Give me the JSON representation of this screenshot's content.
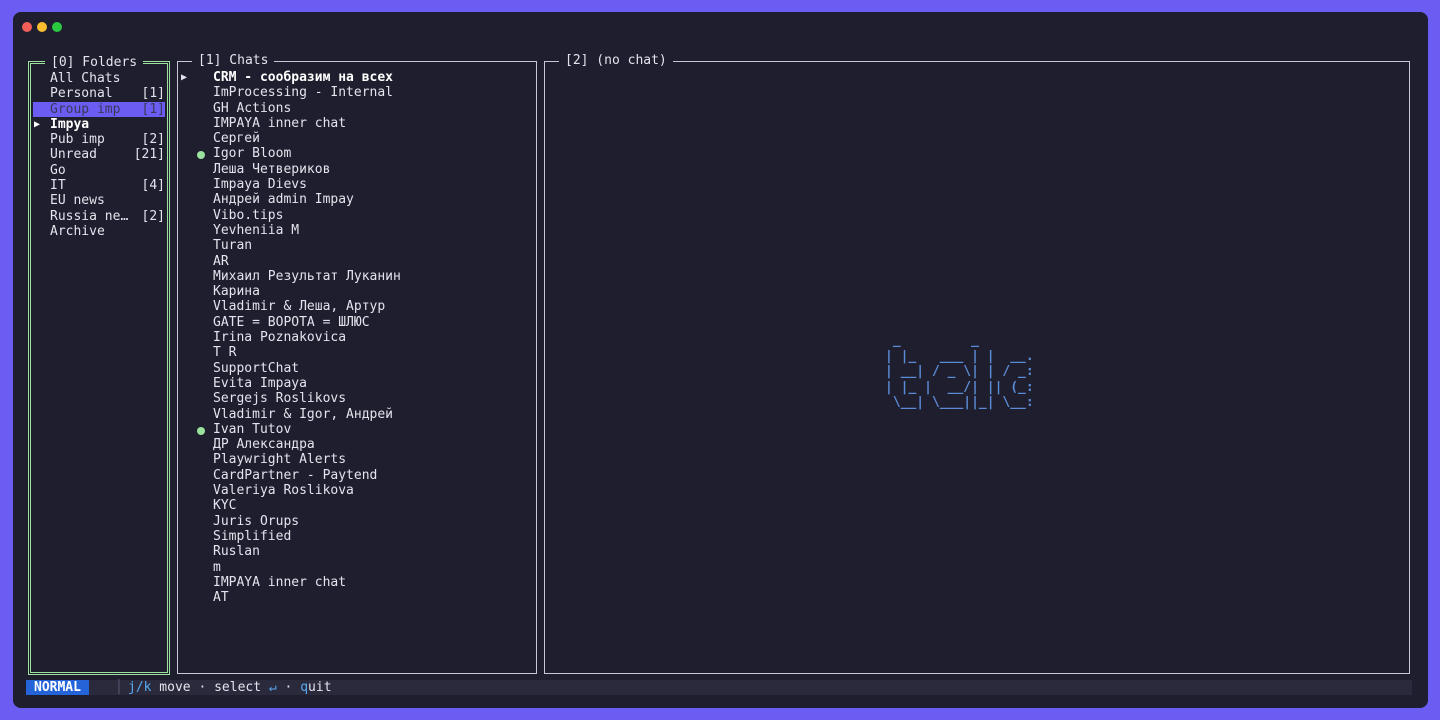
{
  "folders_pane": {
    "title": "[0] Folders",
    "items": [
      {
        "label": "All Chats",
        "count": "",
        "selected": false,
        "active": false
      },
      {
        "label": "Personal",
        "count": "[1]",
        "selected": false,
        "active": false
      },
      {
        "label": "Group imp",
        "count": "[1]",
        "selected": true,
        "active": false
      },
      {
        "label": "Impya",
        "count": "",
        "selected": false,
        "active": true
      },
      {
        "label": "Pub imp",
        "count": "[2]",
        "selected": false,
        "active": false
      },
      {
        "label": "Unread",
        "count": "[21]",
        "selected": false,
        "active": false
      },
      {
        "label": "Go",
        "count": "",
        "selected": false,
        "active": false
      },
      {
        "label": "IT",
        "count": "[4]",
        "selected": false,
        "active": false
      },
      {
        "label": "EU news",
        "count": "",
        "selected": false,
        "active": false
      },
      {
        "label": "Russia ne…",
        "count": "[2]",
        "selected": false,
        "active": false
      },
      {
        "label": "Archive",
        "count": "",
        "selected": false,
        "active": false
      }
    ]
  },
  "chats_pane": {
    "title": "[1] Chats",
    "items": [
      {
        "name": "CRM - сообразим на всех",
        "active": true,
        "online": false
      },
      {
        "name": "ImProcessing - Internal",
        "active": false,
        "online": false
      },
      {
        "name": "GH Actions",
        "active": false,
        "online": false
      },
      {
        "name": "IMPAYA inner chat",
        "active": false,
        "online": false
      },
      {
        "name": "Сергей",
        "active": false,
        "online": false
      },
      {
        "name": "Igor Bloom",
        "active": false,
        "online": true
      },
      {
        "name": "Леша Четвериков",
        "active": false,
        "online": false
      },
      {
        "name": "Impaya Dievs",
        "active": false,
        "online": false
      },
      {
        "name": "Андрей admin Impay",
        "active": false,
        "online": false
      },
      {
        "name": "Vibo.tips",
        "active": false,
        "online": false
      },
      {
        "name": "Yevheniia M",
        "active": false,
        "online": false
      },
      {
        "name": "Turan",
        "active": false,
        "online": false
      },
      {
        "name": "AR",
        "active": false,
        "online": false
      },
      {
        "name": "Михаил Результат Луканин",
        "active": false,
        "online": false
      },
      {
        "name": "Карина",
        "active": false,
        "online": false
      },
      {
        "name": "Vladimir & Леша, Артур",
        "active": false,
        "online": false
      },
      {
        "name": "GATE = ВОРОТА = ШЛЮС",
        "active": false,
        "online": false
      },
      {
        "name": "Irina Poznakovica",
        "active": false,
        "online": false
      },
      {
        "name": "T R",
        "active": false,
        "online": false
      },
      {
        "name": "SupportChat",
        "active": false,
        "online": false
      },
      {
        "name": "Evita Impaya",
        "active": false,
        "online": false
      },
      {
        "name": "Sergejs Roslikovs",
        "active": false,
        "online": false
      },
      {
        "name": "Vladimir & Igor, Андрей",
        "active": false,
        "online": false
      },
      {
        "name": "Ivan Tutov",
        "active": false,
        "online": true
      },
      {
        "name": "ДР Александра",
        "active": false,
        "online": false
      },
      {
        "name": "Playwright Alerts",
        "active": false,
        "online": false
      },
      {
        "name": "CardPartner - Paytend",
        "active": false,
        "online": false
      },
      {
        "name": "Valeriya Roslikova",
        "active": false,
        "online": false
      },
      {
        "name": "KYC",
        "active": false,
        "online": false
      },
      {
        "name": "Juris Orups",
        "active": false,
        "online": false
      },
      {
        "name": "Simplified",
        "active": false,
        "online": false
      },
      {
        "name": "Ruslan",
        "active": false,
        "online": false
      },
      {
        "name": "m",
        "active": false,
        "online": false
      },
      {
        "name": "IMPAYA inner chat",
        "active": false,
        "online": false
      },
      {
        "name": "AT",
        "active": false,
        "online": false
      }
    ]
  },
  "chat_view": {
    "title": "[2] (no chat)",
    "logo_ascii": " _         _         \n| |_   ___ | |  __.  \n| __| / _ \\| | / _:  \n| |_ |  __/| || (_:  \n \\__| \\___||_| \\__:  "
  },
  "status_bar": {
    "mode": "NORMAL",
    "separator": "│",
    "hints": [
      {
        "key": "j/k",
        "text": " move"
      },
      {
        "key": "",
        "text": " · select "
      },
      {
        "key": "↵",
        "text": ""
      },
      {
        "key": "",
        "text": " · "
      },
      {
        "key": "q",
        "text": "uit"
      }
    ]
  },
  "colors": {
    "background": "#6b5cf2",
    "terminal": "#1e1e2e",
    "selection": "#6b5cf2",
    "focus_border": "#9be29f",
    "online_dot": "#9be29f",
    "mode_badge": "#2563d9",
    "key_hint": "#5aa9f0",
    "logo": "#5b8bd6"
  }
}
